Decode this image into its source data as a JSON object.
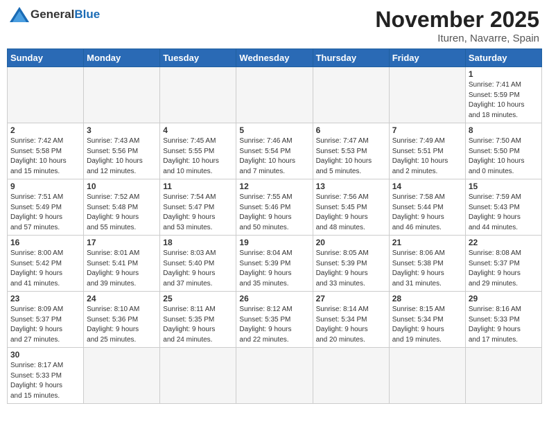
{
  "header": {
    "logo_general": "General",
    "logo_blue": "Blue",
    "title": "November 2025",
    "subtitle": "Ituren, Navarre, Spain"
  },
  "weekdays": [
    "Sunday",
    "Monday",
    "Tuesday",
    "Wednesday",
    "Thursday",
    "Friday",
    "Saturday"
  ],
  "weeks": [
    [
      {
        "day": "",
        "info": ""
      },
      {
        "day": "",
        "info": ""
      },
      {
        "day": "",
        "info": ""
      },
      {
        "day": "",
        "info": ""
      },
      {
        "day": "",
        "info": ""
      },
      {
        "day": "",
        "info": ""
      },
      {
        "day": "1",
        "info": "Sunrise: 7:41 AM\nSunset: 5:59 PM\nDaylight: 10 hours\nand 18 minutes."
      }
    ],
    [
      {
        "day": "2",
        "info": "Sunrise: 7:42 AM\nSunset: 5:58 PM\nDaylight: 10 hours\nand 15 minutes."
      },
      {
        "day": "3",
        "info": "Sunrise: 7:43 AM\nSunset: 5:56 PM\nDaylight: 10 hours\nand 12 minutes."
      },
      {
        "day": "4",
        "info": "Sunrise: 7:45 AM\nSunset: 5:55 PM\nDaylight: 10 hours\nand 10 minutes."
      },
      {
        "day": "5",
        "info": "Sunrise: 7:46 AM\nSunset: 5:54 PM\nDaylight: 10 hours\nand 7 minutes."
      },
      {
        "day": "6",
        "info": "Sunrise: 7:47 AM\nSunset: 5:53 PM\nDaylight: 10 hours\nand 5 minutes."
      },
      {
        "day": "7",
        "info": "Sunrise: 7:49 AM\nSunset: 5:51 PM\nDaylight: 10 hours\nand 2 minutes."
      },
      {
        "day": "8",
        "info": "Sunrise: 7:50 AM\nSunset: 5:50 PM\nDaylight: 10 hours\nand 0 minutes."
      }
    ],
    [
      {
        "day": "9",
        "info": "Sunrise: 7:51 AM\nSunset: 5:49 PM\nDaylight: 9 hours\nand 57 minutes."
      },
      {
        "day": "10",
        "info": "Sunrise: 7:52 AM\nSunset: 5:48 PM\nDaylight: 9 hours\nand 55 minutes."
      },
      {
        "day": "11",
        "info": "Sunrise: 7:54 AM\nSunset: 5:47 PM\nDaylight: 9 hours\nand 53 minutes."
      },
      {
        "day": "12",
        "info": "Sunrise: 7:55 AM\nSunset: 5:46 PM\nDaylight: 9 hours\nand 50 minutes."
      },
      {
        "day": "13",
        "info": "Sunrise: 7:56 AM\nSunset: 5:45 PM\nDaylight: 9 hours\nand 48 minutes."
      },
      {
        "day": "14",
        "info": "Sunrise: 7:58 AM\nSunset: 5:44 PM\nDaylight: 9 hours\nand 46 minutes."
      },
      {
        "day": "15",
        "info": "Sunrise: 7:59 AM\nSunset: 5:43 PM\nDaylight: 9 hours\nand 44 minutes."
      }
    ],
    [
      {
        "day": "16",
        "info": "Sunrise: 8:00 AM\nSunset: 5:42 PM\nDaylight: 9 hours\nand 41 minutes."
      },
      {
        "day": "17",
        "info": "Sunrise: 8:01 AM\nSunset: 5:41 PM\nDaylight: 9 hours\nand 39 minutes."
      },
      {
        "day": "18",
        "info": "Sunrise: 8:03 AM\nSunset: 5:40 PM\nDaylight: 9 hours\nand 37 minutes."
      },
      {
        "day": "19",
        "info": "Sunrise: 8:04 AM\nSunset: 5:39 PM\nDaylight: 9 hours\nand 35 minutes."
      },
      {
        "day": "20",
        "info": "Sunrise: 8:05 AM\nSunset: 5:39 PM\nDaylight: 9 hours\nand 33 minutes."
      },
      {
        "day": "21",
        "info": "Sunrise: 8:06 AM\nSunset: 5:38 PM\nDaylight: 9 hours\nand 31 minutes."
      },
      {
        "day": "22",
        "info": "Sunrise: 8:08 AM\nSunset: 5:37 PM\nDaylight: 9 hours\nand 29 minutes."
      }
    ],
    [
      {
        "day": "23",
        "info": "Sunrise: 8:09 AM\nSunset: 5:37 PM\nDaylight: 9 hours\nand 27 minutes."
      },
      {
        "day": "24",
        "info": "Sunrise: 8:10 AM\nSunset: 5:36 PM\nDaylight: 9 hours\nand 25 minutes."
      },
      {
        "day": "25",
        "info": "Sunrise: 8:11 AM\nSunset: 5:35 PM\nDaylight: 9 hours\nand 24 minutes."
      },
      {
        "day": "26",
        "info": "Sunrise: 8:12 AM\nSunset: 5:35 PM\nDaylight: 9 hours\nand 22 minutes."
      },
      {
        "day": "27",
        "info": "Sunrise: 8:14 AM\nSunset: 5:34 PM\nDaylight: 9 hours\nand 20 minutes."
      },
      {
        "day": "28",
        "info": "Sunrise: 8:15 AM\nSunset: 5:34 PM\nDaylight: 9 hours\nand 19 minutes."
      },
      {
        "day": "29",
        "info": "Sunrise: 8:16 AM\nSunset: 5:33 PM\nDaylight: 9 hours\nand 17 minutes."
      }
    ],
    [
      {
        "day": "30",
        "info": "Sunrise: 8:17 AM\nSunset: 5:33 PM\nDaylight: 9 hours\nand 15 minutes."
      },
      {
        "day": "",
        "info": ""
      },
      {
        "day": "",
        "info": ""
      },
      {
        "day": "",
        "info": ""
      },
      {
        "day": "",
        "info": ""
      },
      {
        "day": "",
        "info": ""
      },
      {
        "day": "",
        "info": ""
      }
    ]
  ]
}
